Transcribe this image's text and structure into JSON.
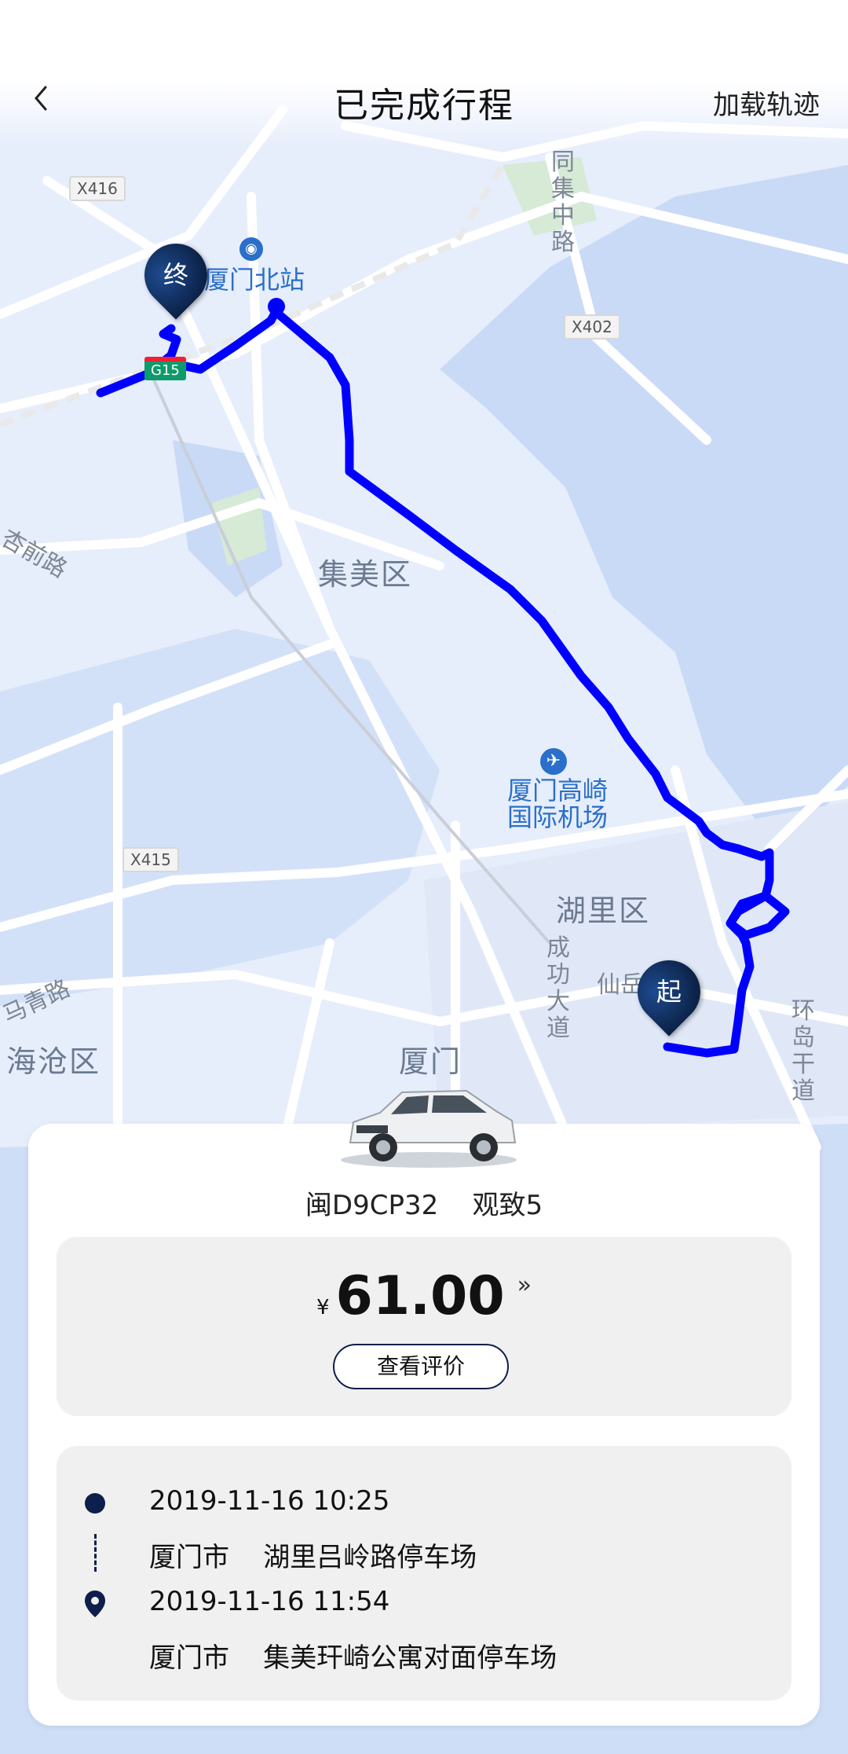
{
  "header": {
    "title": "已完成行程",
    "back_icon": "chevron-left-icon",
    "load_track_label": "加载轨迹"
  },
  "map": {
    "districts": [
      "集美区",
      "湖里区",
      "海沧区",
      "厦门"
    ],
    "pois": {
      "station": "厦门北站",
      "airport_line1": "厦门高崎",
      "airport_line2": "国际机场"
    },
    "roads": {
      "tongji": "同集中路",
      "xingqian": "杏前路",
      "chenggong": "成功大道",
      "huandao": "环岛干道",
      "maqing": "马青路",
      "xianyue": "仙岳"
    },
    "shields": [
      "X416",
      "X402",
      "X415",
      "G15"
    ],
    "start_label": "起",
    "end_label": "终",
    "route_color": "#0000ff"
  },
  "vehicle": {
    "plate_model": "闽D9CP32    观致5"
  },
  "fare": {
    "currency": "¥",
    "amount": "61.00",
    "detail_icon": "double-chevron-right-icon",
    "review_label": "查看评价"
  },
  "trip": {
    "start_time": "2019-11-16 10:25",
    "start_address": "厦门市    湖里吕岭路停车场",
    "end_time": "2019-11-16 11:54",
    "end_address": "厦门市    集美玕崎公寓对面停车场"
  }
}
